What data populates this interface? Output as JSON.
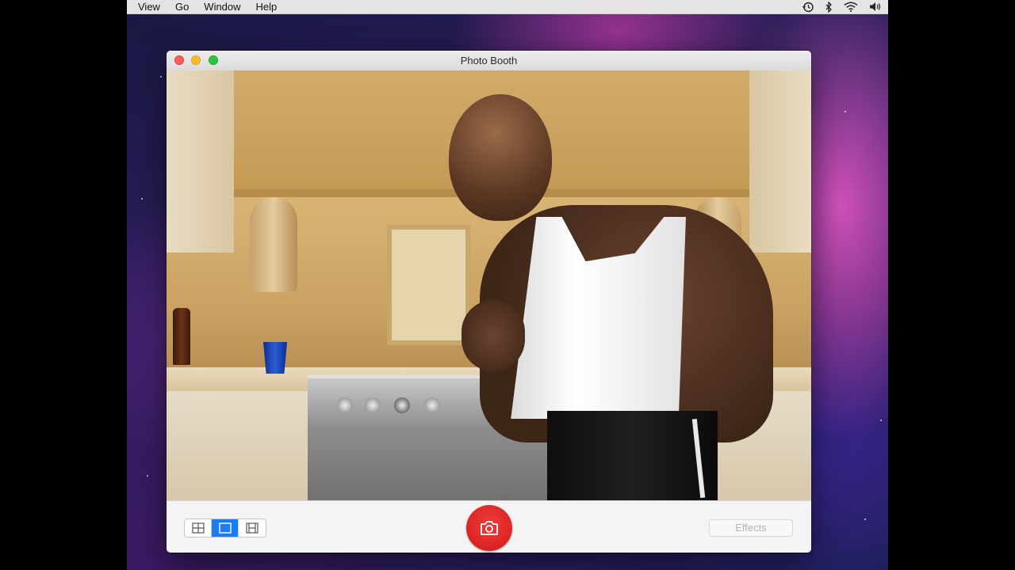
{
  "menubar": {
    "items": [
      {
        "label": "View"
      },
      {
        "label": "Go"
      },
      {
        "label": "Window"
      },
      {
        "label": "Help"
      }
    ],
    "status_icons": [
      "time-machine-icon",
      "bluetooth-icon",
      "wifi-icon",
      "volume-icon"
    ]
  },
  "window": {
    "title": "Photo Booth",
    "traffic_colors": {
      "close": "#fd5f57",
      "minimize": "#fdbc2e",
      "zoom": "#2ac840"
    }
  },
  "camera": {
    "scene": "live-camera-preview"
  },
  "toolbar": {
    "view_modes": [
      {
        "icon": "grid-view-icon",
        "active": false
      },
      {
        "icon": "single-view-icon",
        "active": true
      },
      {
        "icon": "filmstrip-view-icon",
        "active": false
      }
    ],
    "shutter_icon": "camera-icon",
    "shutter_color": "#e22a2a",
    "effects_label": "Effects",
    "active_color": "#1b7cf5"
  }
}
